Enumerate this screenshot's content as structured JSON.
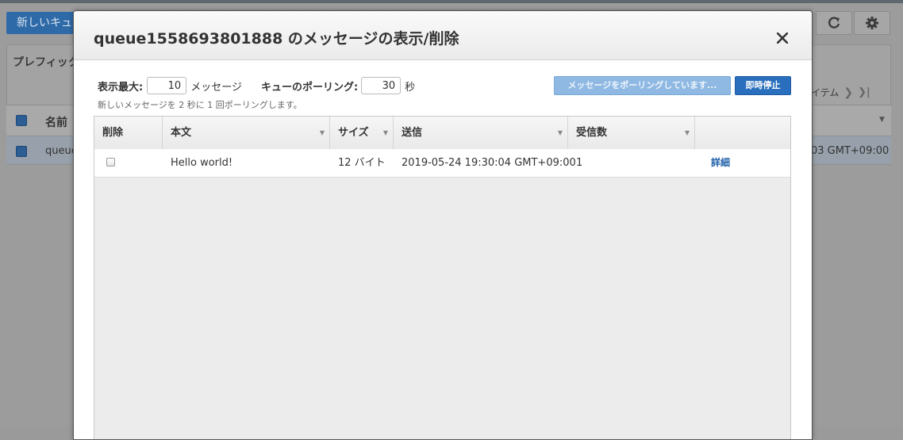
{
  "background": {
    "new_queue_button": "新しいキュ",
    "prefix_label": "プレフィック",
    "items_label": "イテム",
    "name_header": "名前",
    "row_queue": "queue",
    "row_date": "03 GMT+09:00"
  },
  "modal": {
    "title": "queue1558693801888 のメッセージの表示/削除",
    "close_icon": "close-icon",
    "max_display_label": "表示最大:",
    "max_display_value": "10",
    "max_display_unit": "メッセージ",
    "polling_label": "キューのポーリング:",
    "polling_value": "30",
    "polling_unit": "秒",
    "polling_hint": "新しいメッセージを 2 秒に 1 回ポーリングします。",
    "polling_button": "メッセージをポーリングしています...",
    "stop_button": "即時停止",
    "columns": [
      "削除",
      "本文",
      "サイズ",
      "送信",
      "受信数"
    ],
    "rows": [
      {
        "body": "Hello world!",
        "size": "12 バイト",
        "sent": "2019-05-24 19:30:04 GMT+09:00",
        "receive_count": "1",
        "detail": "詳細"
      }
    ]
  },
  "colors": {
    "accent": "#2a6fbd",
    "polling_button_bg": "#8fb9e3",
    "link": "#1d5fa8"
  }
}
